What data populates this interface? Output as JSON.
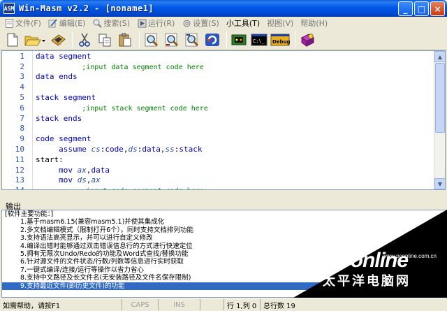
{
  "window": {
    "title": "Win-Masm v2.2 - [noname1]",
    "app_icon_text": "ASM",
    "buttons": {
      "minimize": "_",
      "maximize": "□",
      "close": "×"
    }
  },
  "menu": {
    "items": [
      {
        "label": "文件(F)",
        "icon": "document-icon",
        "active": false
      },
      {
        "label": "编辑(E)",
        "icon": "edit-icon",
        "active": false
      },
      {
        "label": "搜索(S)",
        "icon": "search-icon",
        "active": false
      },
      {
        "label": "运行(R)",
        "icon": "run-icon",
        "active": false
      },
      {
        "label": "设置(S)",
        "icon": "settings-icon",
        "active": false
      },
      {
        "label": "小工具(T)",
        "icon": "",
        "active": true
      },
      {
        "label": "视图(V)",
        "icon": "",
        "active": false
      },
      {
        "label": "帮助(H)",
        "icon": "",
        "active": false
      }
    ]
  },
  "toolbar": {
    "buttons": [
      {
        "name": "new-file",
        "icon": "new-document-icon"
      },
      {
        "name": "open-file",
        "icon": "open-folder-icon"
      },
      {
        "name": "save-file",
        "icon": "save-icon"
      },
      {
        "name": "cut",
        "icon": "scissors-icon"
      },
      {
        "name": "copy",
        "icon": "copy-icon"
      },
      {
        "name": "paste",
        "icon": "paste-icon"
      },
      {
        "name": "find",
        "icon": "magnifier-icon"
      },
      {
        "name": "find-next",
        "icon": "magnifier-next-icon"
      },
      {
        "name": "replace",
        "icon": "magnifier-replace-icon"
      },
      {
        "name": "refresh",
        "icon": "refresh-icon"
      },
      {
        "name": "compile",
        "icon": "chip-icon"
      },
      {
        "name": "run-console",
        "icon": "console-icon"
      },
      {
        "name": "debug",
        "icon": "debug-icon"
      },
      {
        "name": "help",
        "icon": "help-book-icon"
      }
    ],
    "console_text": "C:\\_",
    "debug_text": "Debug"
  },
  "editor": {
    "lines": [
      {
        "n": "1",
        "indent": "",
        "parts": [
          [
            "blue",
            "data segment"
          ]
        ]
      },
      {
        "n": "2",
        "indent": "          ",
        "parts": [
          [
            "cm",
            ";input data segment code here"
          ]
        ]
      },
      {
        "n": "3",
        "indent": "",
        "parts": [
          [
            "blue",
            "data ends"
          ]
        ]
      },
      {
        "n": "4",
        "indent": "",
        "parts": []
      },
      {
        "n": "5",
        "indent": "",
        "parts": [
          [
            "blue",
            "stack segment"
          ]
        ]
      },
      {
        "n": "6",
        "indent": "          ",
        "parts": [
          [
            "cm",
            ";input stack segment code here"
          ]
        ]
      },
      {
        "n": "7",
        "indent": "",
        "parts": [
          [
            "blue",
            "stack ends"
          ]
        ]
      },
      {
        "n": "8",
        "indent": "",
        "parts": []
      },
      {
        "n": "9",
        "indent": "",
        "parts": [
          [
            "blue",
            "code segment"
          ]
        ]
      },
      {
        "n": "10",
        "indent": "     ",
        "parts": [
          [
            "blue",
            "assume "
          ],
          [
            "reg",
            "cs"
          ],
          [
            "plain",
            ":"
          ],
          [
            "blue",
            "code"
          ],
          [
            "plain",
            ","
          ],
          [
            "reg",
            "ds"
          ],
          [
            "plain",
            ":"
          ],
          [
            "blue",
            "data"
          ],
          [
            "plain",
            ","
          ],
          [
            "reg",
            "ss"
          ],
          [
            "plain",
            ":"
          ],
          [
            "blue",
            "stack"
          ]
        ]
      },
      {
        "n": "11",
        "indent": "",
        "parts": [
          [
            "plain",
            "start:"
          ]
        ]
      },
      {
        "n": "12",
        "indent": "     ",
        "parts": [
          [
            "blue",
            "mov "
          ],
          [
            "reg",
            "ax"
          ],
          [
            "plain",
            ","
          ],
          [
            "blue",
            "data"
          ]
        ]
      },
      {
        "n": "13",
        "indent": "     ",
        "parts": [
          [
            "blue",
            "mov "
          ],
          [
            "reg",
            "ds"
          ],
          [
            "plain",
            ","
          ],
          [
            "reg",
            "ax"
          ]
        ]
      },
      {
        "n": "14",
        "indent": "          ",
        "parts": [
          [
            "cm",
            ";input code segment code here"
          ]
        ]
      }
    ]
  },
  "output": {
    "label": "输出",
    "lines": [
      "[软件主要功能：]",
      "1.基于masm6.15(兼容masm5.1)并使其集成化",
      "2.多文档编辑模式（限制打开6个），同时支持文档排列功能",
      "3.支持语法高亮显示，并可以进行自定义修改",
      "4.编译出错时能够通过双击错误信息行的方式进行快速定位",
      "5.拥有无限次Undo/Redo的功能及Word式查找/替换功能",
      "6.针对源文件的文件状态/行数/列数等信息进行实时获取",
      "7.一键式编译/连接/运行等操作以省力省心",
      "8.支持中文路径及长文件名(无安装路径及文件名保存限制)",
      "9.支持最近文件(即历史文件)的功能"
    ],
    "selected_index": 9
  },
  "watermark": {
    "brand": "PConline",
    "url": "www.pconline.com.cn",
    "cn": "太平洋电脑网"
  },
  "status": {
    "help": "如需帮助，请按F1",
    "caps": "CAPS",
    "ins": "INS",
    "position": "行 1,列 0",
    "total": "总行数 19"
  }
}
